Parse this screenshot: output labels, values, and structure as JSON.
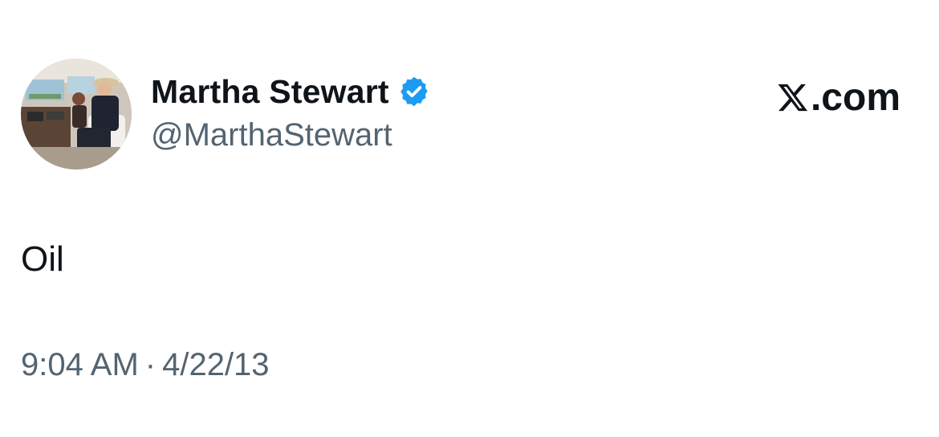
{
  "tweet": {
    "author": {
      "display_name": "Martha Stewart",
      "handle": "@MarthaStewart",
      "verified": true,
      "verified_color": "#1d9bf0",
      "avatar_icon": "avatar-photo-boat-interior"
    },
    "brand": {
      "icon": "x-logo-icon",
      "domain": ".com"
    },
    "text": "Oil",
    "time": "9:04 AM",
    "separator": "·",
    "date": "4/22/13"
  },
  "colors": {
    "primary_text": "#0f1419",
    "secondary_text": "#536471",
    "background": "#ffffff",
    "verified_blue": "#1d9bf0"
  }
}
